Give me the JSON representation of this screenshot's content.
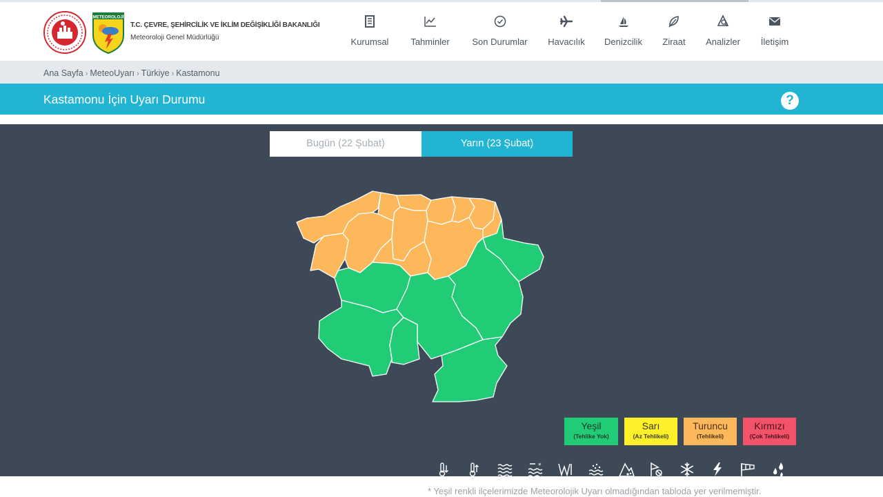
{
  "header": {
    "org_line1": "T.C. ÇEVRE, ŞEHİRCİLİK VE İKLİM DEĞİŞİKLİĞİ BAKANLIĞI",
    "org_line2": "Meteoroloji Genel Müdürlüğü",
    "logo2_text": "METEOROLOJİ"
  },
  "nav": [
    {
      "label": "Kurumsal",
      "icon": "building-icon"
    },
    {
      "label": "Tahminler",
      "icon": "chart-line-icon"
    },
    {
      "label": "Son Durumlar",
      "icon": "clock-check-icon"
    },
    {
      "label": "Havacılık",
      "icon": "airplane-icon"
    },
    {
      "label": "Denizcilik",
      "icon": "sailboat-icon"
    },
    {
      "label": "Ziraat",
      "icon": "leaf-icon"
    },
    {
      "label": "Analizler",
      "icon": "analysis-icon"
    },
    {
      "label": "İletişim",
      "icon": "envelope-icon"
    }
  ],
  "breadcrumb": [
    "Ana Sayfa",
    "MeteoUyarı",
    "Türkiye",
    "Kastamonu"
  ],
  "breadcrumb_sep": "›",
  "page_title": "Kastamonu İçin Uyarı Durumu",
  "help_label": "?",
  "tabs": {
    "today": "Bugün (22 Şubat)",
    "tomorrow": "Yarın (23 Şubat)",
    "selected": "tomorrow"
  },
  "legend": [
    {
      "name": "Yeşil",
      "desc": "(Tehlike Yok)",
      "color": "#22cc77",
      "text_color": "#1d3a2a"
    },
    {
      "name": "Sarı",
      "desc": "(Az Tehlikeli)",
      "color": "#fff02a",
      "text_color": "#3a3a10"
    },
    {
      "name": "Turuncu",
      "desc": "(Tehlikeli)",
      "color": "#fdb85c",
      "text_color": "#4a3010"
    },
    {
      "name": "Kırmızı",
      "desc": "(Çok Tehlikeli)",
      "color": "#f2536b",
      "text_color": "#4a1018"
    }
  ],
  "hazard_icons": [
    "cold-icon",
    "hot-icon",
    "fog-icon",
    "snow-melt-icon",
    "wind-icon",
    "dust-icon",
    "avalanche-icon",
    "hail-icon",
    "snow-icon",
    "lightning-icon",
    "windsock-icon",
    "rain-icon"
  ],
  "map_colors": {
    "orange": "#fdb85c",
    "green": "#22cc77",
    "border": "#ffffff"
  },
  "footnote": "* Yeşil renkli ilçelerimizde Meteorolojik Uyarı olmadığından tabloda yer verilmemiştir."
}
